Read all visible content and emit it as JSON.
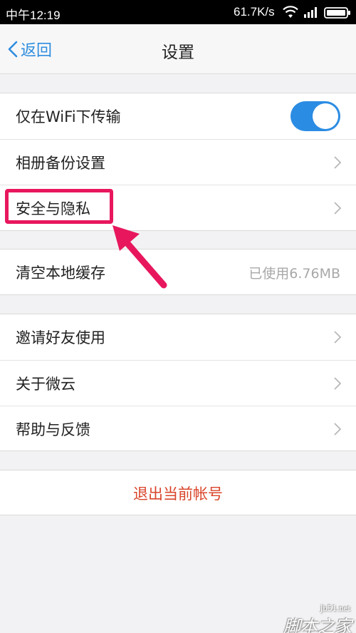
{
  "status_bar": {
    "time": "中午12:19",
    "network_speed": "61.7K/s",
    "icons": [
      "wifi-icon",
      "signal-icon",
      "battery-icon"
    ]
  },
  "nav": {
    "back_label": "返回",
    "title": "设置"
  },
  "settings": {
    "wifi_only": {
      "label": "仅在WiFi下传输",
      "enabled": true
    },
    "album_backup": {
      "label": "相册备份设置"
    },
    "security_privacy": {
      "label": "安全与隐私"
    },
    "clear_cache": {
      "label": "清空本地缓存",
      "value": "已使用6.76MB"
    },
    "invite_friends": {
      "label": "邀请好友使用"
    },
    "about": {
      "label": "关于微云"
    },
    "help_feedback": {
      "label": "帮助与反馈"
    },
    "logout": {
      "label": "退出当前帐号"
    }
  },
  "watermark": {
    "url": "jb51.net",
    "name": "脚本之家"
  },
  "colors": {
    "accent": "#2f8ede",
    "toggle_on": "#2b8ce3",
    "logout_red": "#d9452b",
    "annotation_pink": "#e8175d"
  }
}
